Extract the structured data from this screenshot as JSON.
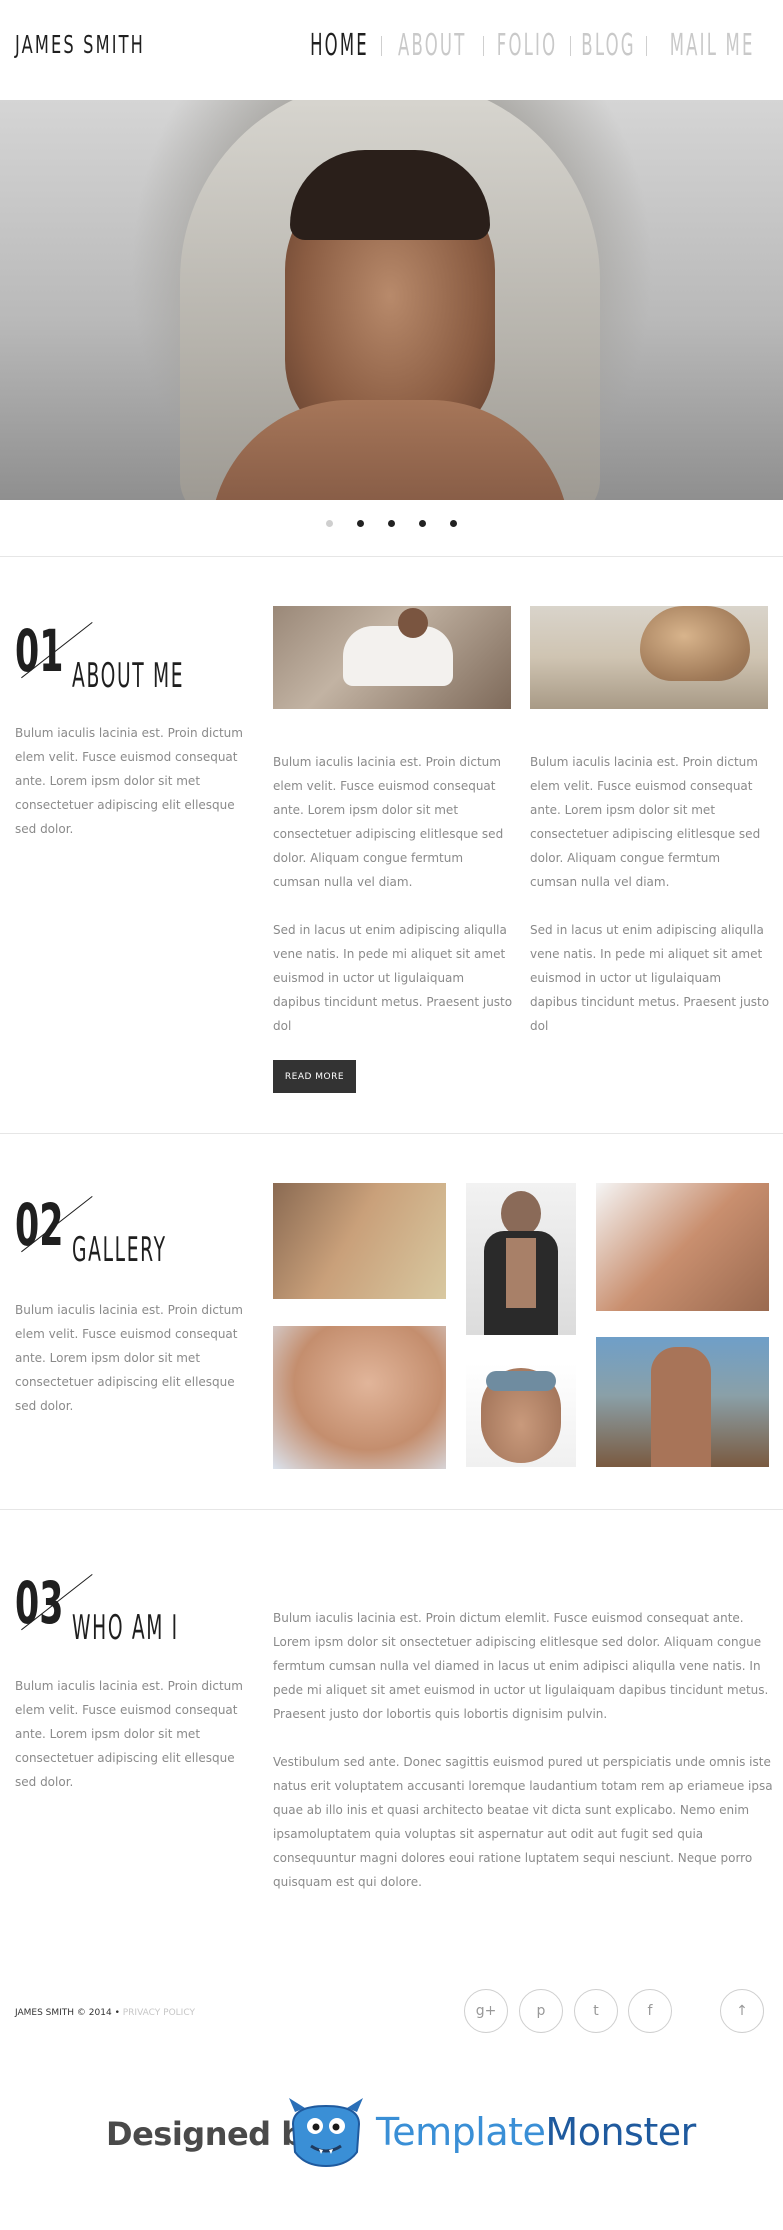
{
  "header": {
    "logo": "JAMES SMITH",
    "nav": [
      "HOME",
      "ABOUT",
      "FOLIO",
      "BLOG",
      "MAIL ME"
    ]
  },
  "slider": {
    "dots": 5,
    "active_dot": 1
  },
  "about": {
    "number": "01",
    "title": "ABOUT ME",
    "intro": "Bulum iaculis lacinia est. Proin dictum elem velit. Fusce euismod consequat ante. Lorem ipsm dolor sit met consectetuer adipiscing elit ellesque sed dolor.",
    "col1_p1": "Bulum iaculis lacinia est. Proin dictum elem velit. Fusce euismod consequat ante. Lorem ipsm dolor sit met consectetuer adipiscing elitlesque sed dolor. Aliquam congue fermtum cumsan nulla vel diam.",
    "col1_p2": "Sed in lacus ut enim adipiscing aliqulla vene natis. In pede mi aliquet sit amet euismod in uctor ut ligulaiquam dapibus tincidunt metus. Praesent justo dol",
    "col2_p1": "Bulum iaculis lacinia est. Proin dictum elem velit. Fusce euismod consequat ante. Lorem ipsm dolor sit met consectetuer adipiscing elitlesque sed dolor. Aliquam congue fermtum cumsan nulla vel diam.",
    "col2_p2": "Sed in lacus ut enim adipiscing aliqulla vene natis. In pede mi aliquet sit amet euismod in uctor ut ligulaiquam dapibus tincidunt metus. Praesent justo dol",
    "read_more": "READ MORE"
  },
  "gallery": {
    "number": "02",
    "title": "GALLERY",
    "intro": "Bulum iaculis lacinia est. Proin dictum elem velit. Fusce euismod consequat ante. Lorem ipsm dolor sit met consectetuer adipiscing elit ellesque sed dolor."
  },
  "who": {
    "number": "03",
    "title": "WHO AM I",
    "intro": "Bulum iaculis lacinia est. Proin dictum elem velit. Fusce euismod consequat ante. Lorem ipsm dolor sit met consectetuer adipiscing elit ellesque sed dolor.",
    "p1": "Bulum iaculis lacinia est. Proin dictum elemlit. Fusce euismod consequat ante. Lorem ipsm dolor sit onsectetuer adipiscing elitlesque sed dolor. Aliquam congue fermtum cumsan nulla vel diamed in lacus ut enim adipisci aliqulla vene natis. In pede mi aliquet sit amet euismod in uctor ut ligulaiquam dapibus tincidunt metus. Praesent justo dor lobortis quis lobortis dignisim pulvin.",
    "p2": "Vestibulum sed ante. Donec sagittis euismod pured ut perspiciatis unde omnis iste natus erit voluptatem accusanti loremque laudantium totam rem ap eriameue ipsa quae ab illo inis et quasi architecto beatae vit dicta sunt explicabo. Nemo enim ipsamoluptatem quia voluptas sit aspernatur aut odit aut fugit sed quia consequuntur magni dolores eoui ratione luptatem sequi nesciunt. Neque porro quisquam est qui dolore."
  },
  "footer": {
    "copyright": "JAMES SMITH © 2014 •",
    "privacy": "PRIVACY POLICY",
    "social_icons": [
      "google-plus-icon",
      "pinterest-icon",
      "twitter-icon",
      "facebook-icon"
    ],
    "google_plus": "g+",
    "pinterest": "p",
    "twitter": "t",
    "facebook": "f",
    "up_arrow": "↑"
  },
  "credit": {
    "designed_by": "Designed by",
    "brand_part1": "Template",
    "brand_part2": "Monster"
  },
  "colors": {
    "accent_dark": "#333333",
    "brand_light_blue": "#3a8fd6",
    "brand_dark_blue": "#1f5a9e"
  }
}
